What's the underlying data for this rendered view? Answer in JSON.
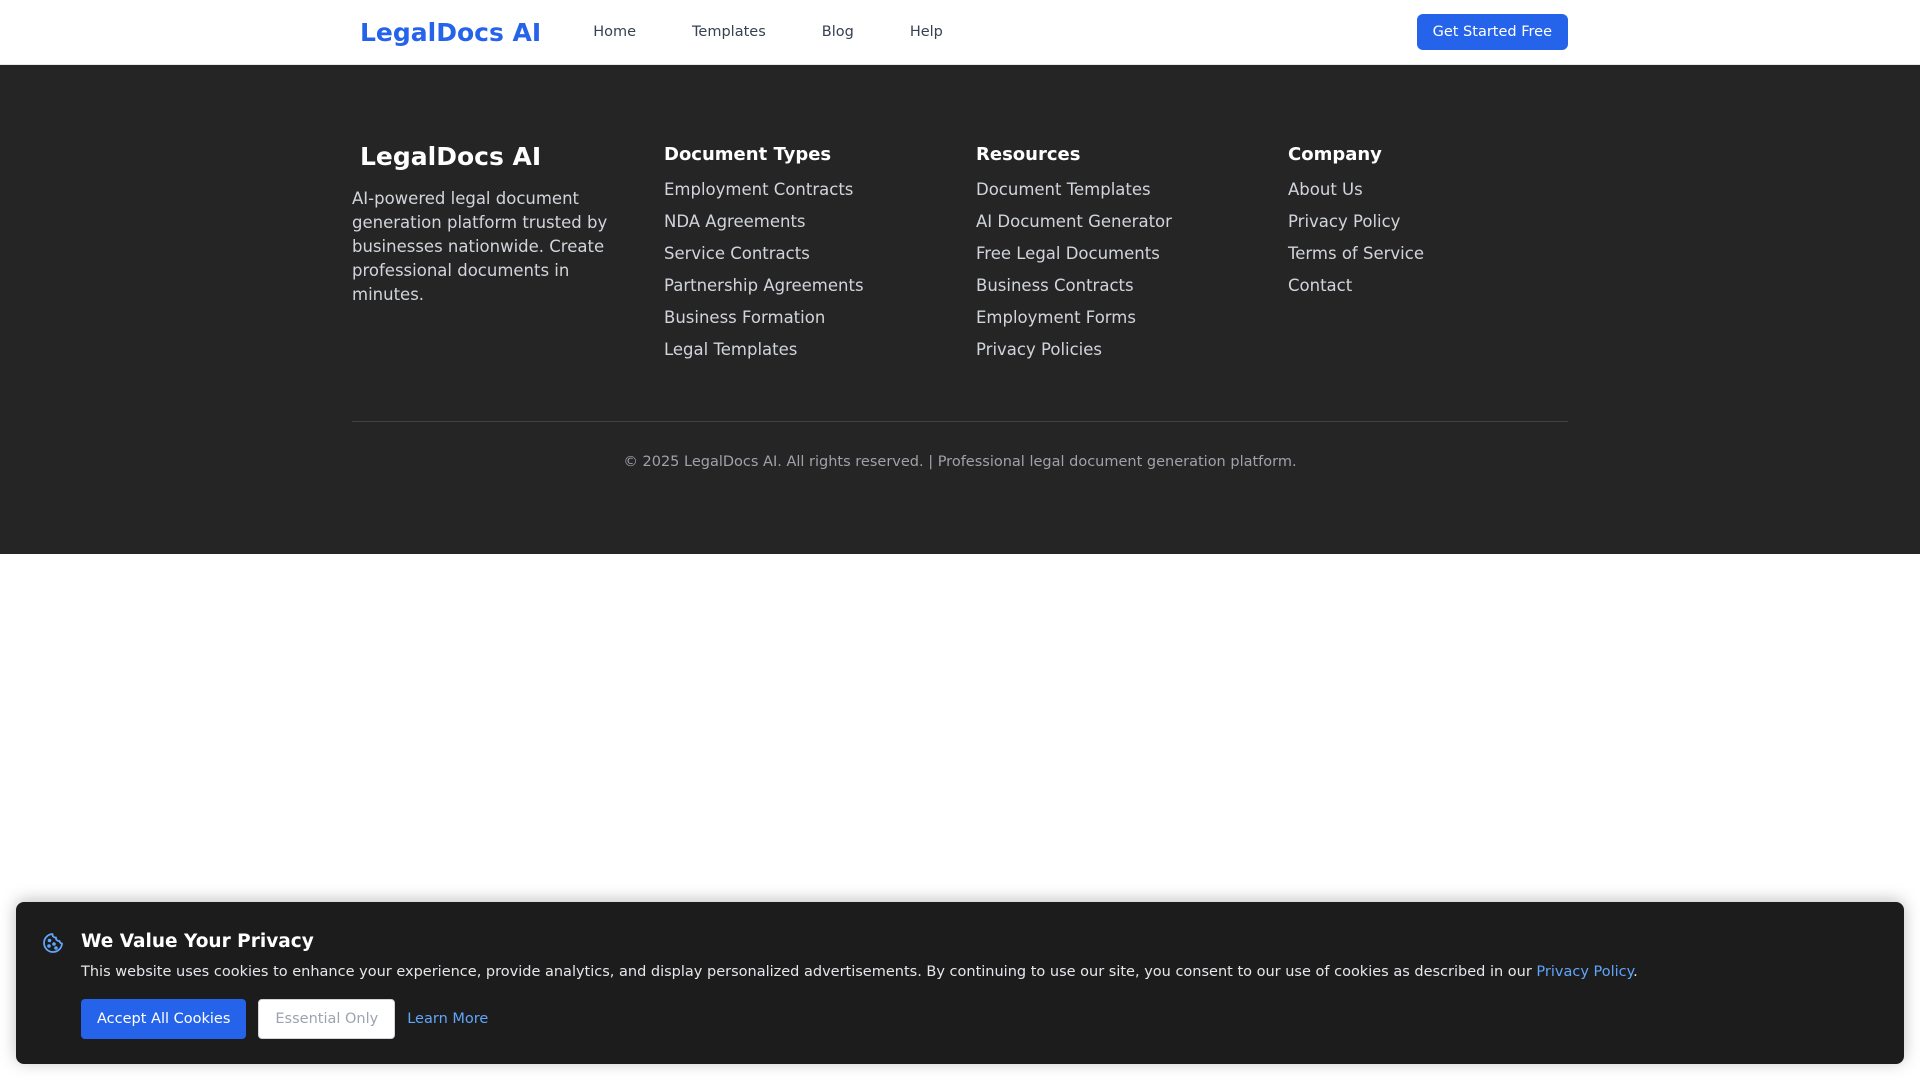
{
  "header": {
    "brand": "LegalDocs AI",
    "nav": [
      "Home",
      "Templates",
      "Blog",
      "Help"
    ],
    "cta": "Get Started Free"
  },
  "footer": {
    "brand": "LegalDocs AI",
    "description": "AI-powered legal document generation platform trusted by businesses nationwide. Create professional documents in minutes.",
    "columns": [
      {
        "title": "Document Types",
        "links": [
          "Employment Contracts",
          "NDA Agreements",
          "Service Contracts",
          "Partnership Agreements",
          "Business Formation",
          "Legal Templates"
        ]
      },
      {
        "title": "Resources",
        "links": [
          "Document Templates",
          "AI Document Generator",
          "Free Legal Documents",
          "Business Contracts",
          "Employment Forms",
          "Privacy Policies"
        ]
      },
      {
        "title": "Company",
        "links": [
          "About Us",
          "Privacy Policy",
          "Terms of Service",
          "Contact"
        ]
      }
    ],
    "copyright": "© 2025 LegalDocs AI. All rights reserved. | Professional legal document generation platform."
  },
  "cookie_banner": {
    "icon": "cookie-icon",
    "title": "We Value Your Privacy",
    "text_before_link": "This website uses cookies to enhance your experience, provide analytics, and display personalized advertisements. By continuing to use our site, you consent to our use of cookies as described in our ",
    "link_text": "Privacy Policy",
    "text_after_link": ".",
    "accept_label": "Accept All Cookies",
    "essential_label": "Essential Only",
    "learn_more_label": "Learn More"
  },
  "colors": {
    "brand_blue": "#2563eb",
    "footer_bg": "#252525",
    "banner_bg": "#1c1c1c",
    "link_blue": "#60a5fa"
  }
}
